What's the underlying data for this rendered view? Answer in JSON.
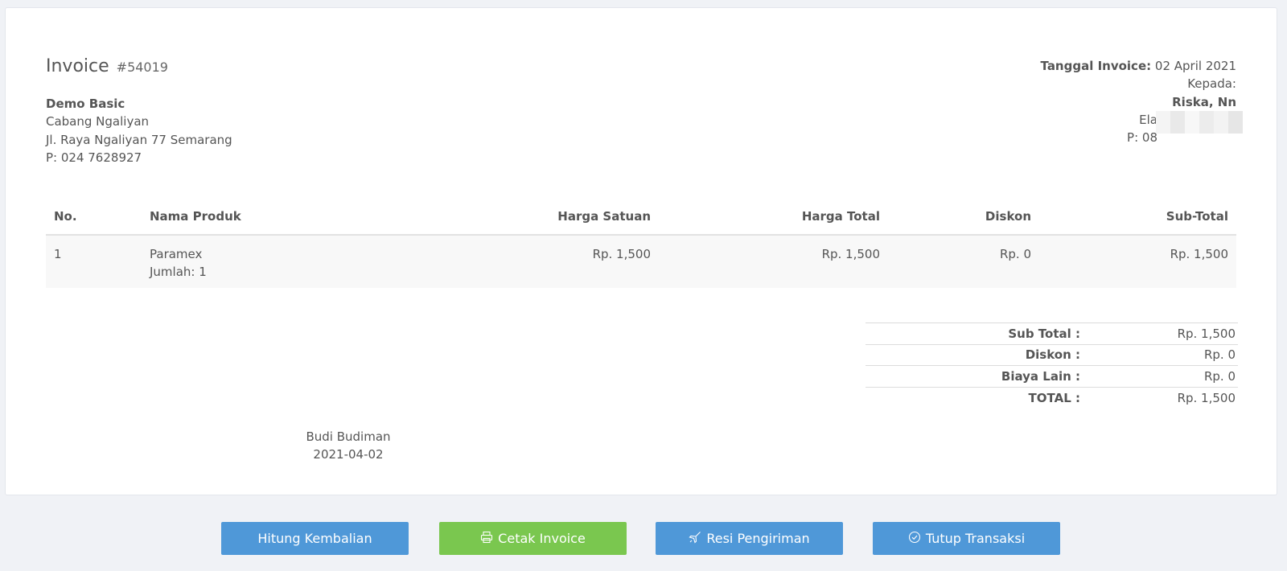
{
  "invoice": {
    "title": "Invoice",
    "number": "#54019"
  },
  "company": {
    "name": "Demo Basic",
    "branch": "Cabang Ngaliyan",
    "address": "Jl. Raya Ngaliyan 77 Semarang",
    "phone": "P: 024 7628927"
  },
  "recipient": {
    "date_label": "Tanggal Invoice:",
    "date_value": "02 April 2021",
    "to_label": "Kepada:",
    "name": "Riska, Nn",
    "line1": "Ela",
    "line2": "P: 08"
  },
  "table": {
    "headers": [
      "No.",
      "Nama Produk",
      "Harga Satuan",
      "Harga Total",
      "Diskon",
      "Sub-Total"
    ],
    "rows": [
      {
        "no": "1",
        "product": "Paramex",
        "qty": "Jumlah: 1",
        "unit_price": "Rp. 1,500",
        "total_price": "Rp. 1,500",
        "discount": "Rp. 0",
        "subtotal": "Rp. 1,500"
      }
    ]
  },
  "summary": [
    {
      "label": "Sub Total :",
      "value": "Rp. 1,500"
    },
    {
      "label": "Diskon :",
      "value": "Rp. 0"
    },
    {
      "label": "Biaya Lain :",
      "value": "Rp. 0"
    },
    {
      "label": "TOTAL :",
      "value": "Rp. 1,500"
    }
  ],
  "signature": {
    "name": "Budi Budiman",
    "date": "2021-04-02"
  },
  "buttons": {
    "change": "Hitung Kembalian",
    "print": "Cetak Invoice",
    "shipping": "Resi Pengiriman",
    "close": "Tutup Transaksi"
  },
  "colors": {
    "blue_button": "#4f98d8",
    "green_button": "#7ac74f",
    "background": "#f0f2f6"
  }
}
